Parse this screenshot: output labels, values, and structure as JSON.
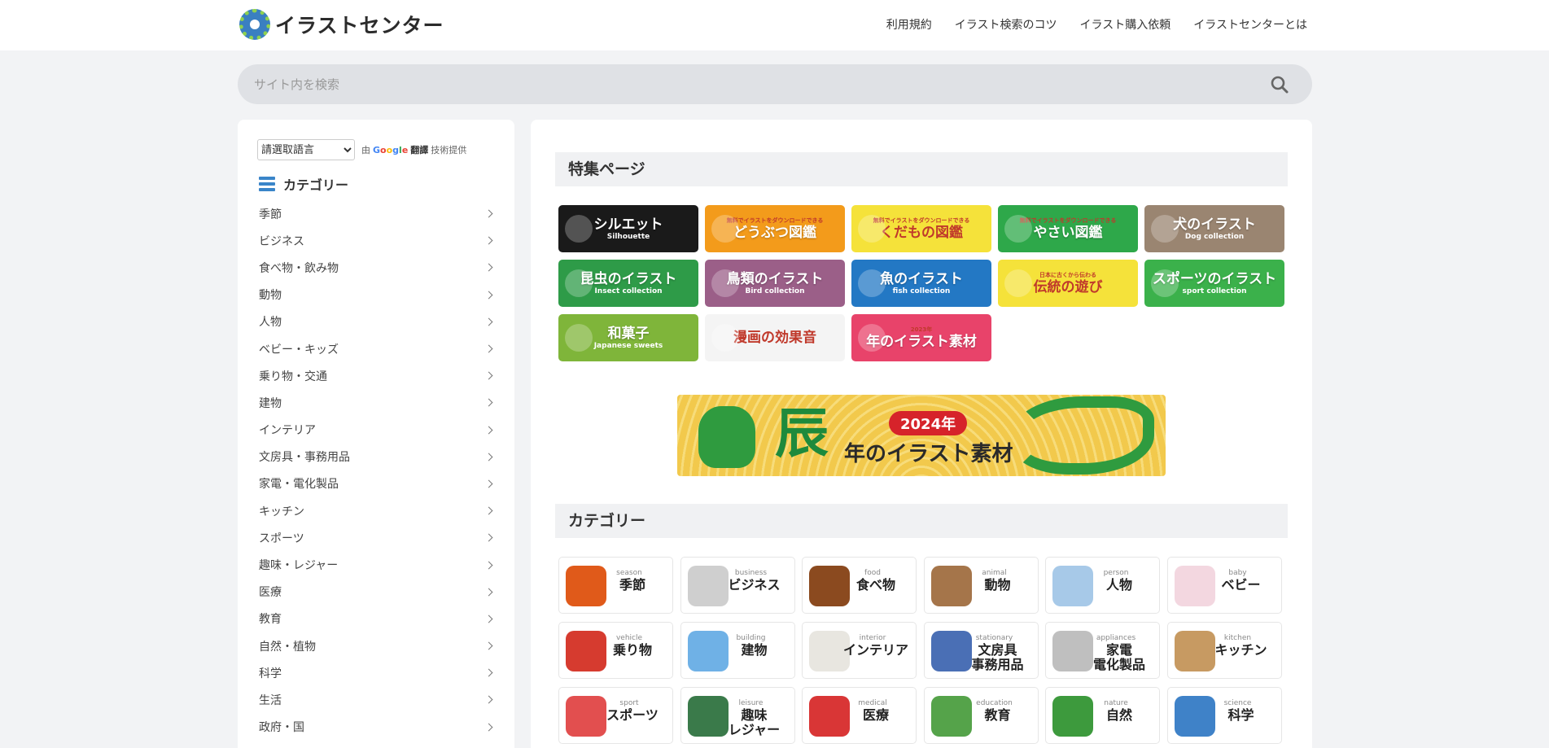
{
  "header": {
    "logo_text": "イラストセンター",
    "nav": [
      "利用規約",
      "イラスト検索のコツ",
      "イラスト購入依頼",
      "イラストセンターとは"
    ]
  },
  "search": {
    "placeholder": "サイト内を検索"
  },
  "sidebar": {
    "language_select": "請選取語言",
    "powered_by_prefix": "由",
    "powered_by_google": "Google",
    "powered_by_translate": "翻譯",
    "powered_by_suffix": "技術提供",
    "category_title": "カテゴリー",
    "categories": [
      "季節",
      "ビジネス",
      "食べ物・飲み物",
      "動物",
      "人物",
      "ベビー・キッズ",
      "乗り物・交通",
      "建物",
      "インテリア",
      "文房具・事務用品",
      "家電・電化製品",
      "キッチン",
      "スポーツ",
      "趣味・レジャー",
      "医療",
      "教育",
      "自然・植物",
      "科学",
      "生活",
      "政府・国"
    ]
  },
  "main": {
    "featured_title": "特集ページ",
    "featured": [
      {
        "title": "シルエット",
        "sub": "Silhouette",
        "small": "",
        "color": "#1a1a1a"
      },
      {
        "title": "どうぶつ図鑑",
        "sub": "",
        "small": "無料でイラストをダウンロードできる",
        "color": "#f39b1b"
      },
      {
        "title": "くだもの図鑑",
        "sub": "",
        "small": "無料でイラストをダウンロードできる",
        "color": "#f5e23a"
      },
      {
        "title": "やさい図鑑",
        "sub": "",
        "small": "無料でイラストをダウンロードできる",
        "color": "#2ea84a"
      },
      {
        "title": "犬のイラスト",
        "sub": "Dog collection",
        "small": "",
        "color": "#9a8571"
      },
      {
        "title": "昆虫のイラスト",
        "sub": "Insect collection",
        "small": "",
        "color": "#2e9b48"
      },
      {
        "title": "鳥類のイラスト",
        "sub": "Bird collection",
        "small": "",
        "color": "#9b5f88"
      },
      {
        "title": "魚のイラスト",
        "sub": "fish collection",
        "small": "",
        "color": "#2378c4"
      },
      {
        "title": "伝統の遊び",
        "sub": "",
        "small": "日本に古くから伝わる",
        "color": "#f5e23a"
      },
      {
        "title": "スポーツのイラスト",
        "sub": "sport collection",
        "small": "",
        "color": "#3bb14b"
      },
      {
        "title": "和菓子",
        "sub": "Japanese sweets",
        "small": "",
        "color": "#7fb53a"
      },
      {
        "title": "漫画の効果音",
        "sub": "",
        "small": "",
        "color": "#f4f4f4"
      },
      {
        "title": "年のイラスト素材",
        "sub": "",
        "small": "2023年",
        "color": "#e8436a"
      }
    ],
    "banner": {
      "kanji": "辰",
      "year": "2024年",
      "text": "年のイラスト素材"
    },
    "category_title": "カテゴリー",
    "category_cards": [
      {
        "en": "season",
        "jp": "季節",
        "color": "#e05a1a"
      },
      {
        "en": "business",
        "jp": "ビジネス",
        "color": "#cfcfcf"
      },
      {
        "en": "food",
        "jp": "食べ物",
        "color": "#8b4a1f"
      },
      {
        "en": "animal",
        "jp": "動物",
        "color": "#a5754a"
      },
      {
        "en": "person",
        "jp": "人物",
        "color": "#a7c9e8"
      },
      {
        "en": "baby",
        "jp": "ベビー",
        "color": "#f3d7e0"
      },
      {
        "en": "vehicle",
        "jp": "乗り物",
        "color": "#d63b2f"
      },
      {
        "en": "building",
        "jp": "建物",
        "color": "#6fb1e6"
      },
      {
        "en": "interior",
        "jp": "インテリア",
        "color": "#e8e6e0"
      },
      {
        "en": "stationary",
        "jp": "文房具\n事務用品",
        "color": "#4a6fb5"
      },
      {
        "en": "appliances",
        "jp": "家電\n電化製品",
        "color": "#bfbfbf"
      },
      {
        "en": "kitchen",
        "jp": "キッチン",
        "color": "#c79a62"
      },
      {
        "en": "sport",
        "jp": "スポーツ",
        "color": "#e24f4f"
      },
      {
        "en": "leisure",
        "jp": "趣味\nレジャー",
        "color": "#3a7a4a"
      },
      {
        "en": "medical",
        "jp": "医療",
        "color": "#d93636"
      },
      {
        "en": "education",
        "jp": "教育",
        "color": "#55a34a"
      },
      {
        "en": "nature",
        "jp": "自然",
        "color": "#3d9a3d"
      },
      {
        "en": "science",
        "jp": "科学",
        "color": "#3f82c8"
      }
    ]
  }
}
